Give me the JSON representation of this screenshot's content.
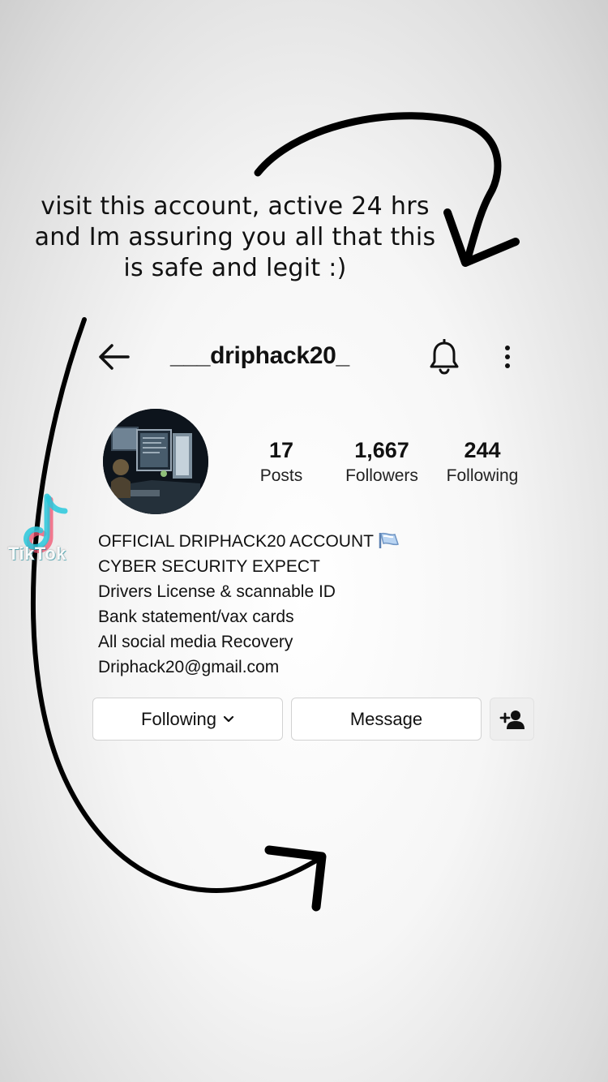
{
  "caption": {
    "line1": "visit this account, active 24 hrs",
    "line2": "and Im assuring you all that this",
    "line3": "is safe and legit :)"
  },
  "watermark": {
    "text": "TikTok"
  },
  "profile": {
    "username": "___driphack20_",
    "stats": {
      "posts": {
        "value": "17",
        "label": "Posts"
      },
      "followers": {
        "value": "1,667",
        "label": "Followers"
      },
      "following": {
        "value": "244",
        "label": "Following"
      }
    },
    "bio": [
      "OFFICIAL DRIPHACK20 ACCOUNT",
      "CYBER SECURITY EXPECT",
      "Drivers License & scannable ID",
      "Bank statement/vax cards",
      "All social media Recovery",
      "Driphack20@gmail.com"
    ]
  },
  "buttons": {
    "following": "Following",
    "message": "Message"
  },
  "icons": {
    "back": "arrow-left-icon",
    "bell": "bell-icon",
    "more": "more-vertical-icon",
    "add_user": "add-user-icon",
    "chevron": "chevron-down-icon"
  }
}
